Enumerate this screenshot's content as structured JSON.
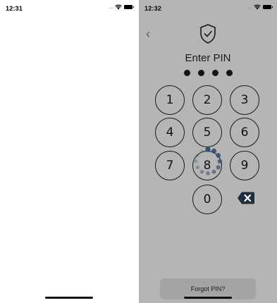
{
  "left_screen": {
    "status": {
      "time": "12:31",
      "signal": "....."
    }
  },
  "right_screen": {
    "status": {
      "time": "12:32",
      "signal": "....."
    },
    "header": {
      "back_icon": "chevron-left-icon",
      "logo_icon": "shield-check-icon"
    },
    "title": "Enter PIN",
    "pin_entered_count": 4,
    "keypad": {
      "k1": "1",
      "k2": "2",
      "k3": "3",
      "k4": "4",
      "k5": "5",
      "k6": "6",
      "k7": "7",
      "k8": "8",
      "k9": "9",
      "k0": "0"
    },
    "backspace_icon": "backspace-icon",
    "loading_icon": "spinner-icon",
    "forgot_label": "Forgot PIN?"
  },
  "colors": {
    "overlay": "#b5b5b5",
    "backspace": "#1f2e3f",
    "spinner": "#2f4f70"
  }
}
